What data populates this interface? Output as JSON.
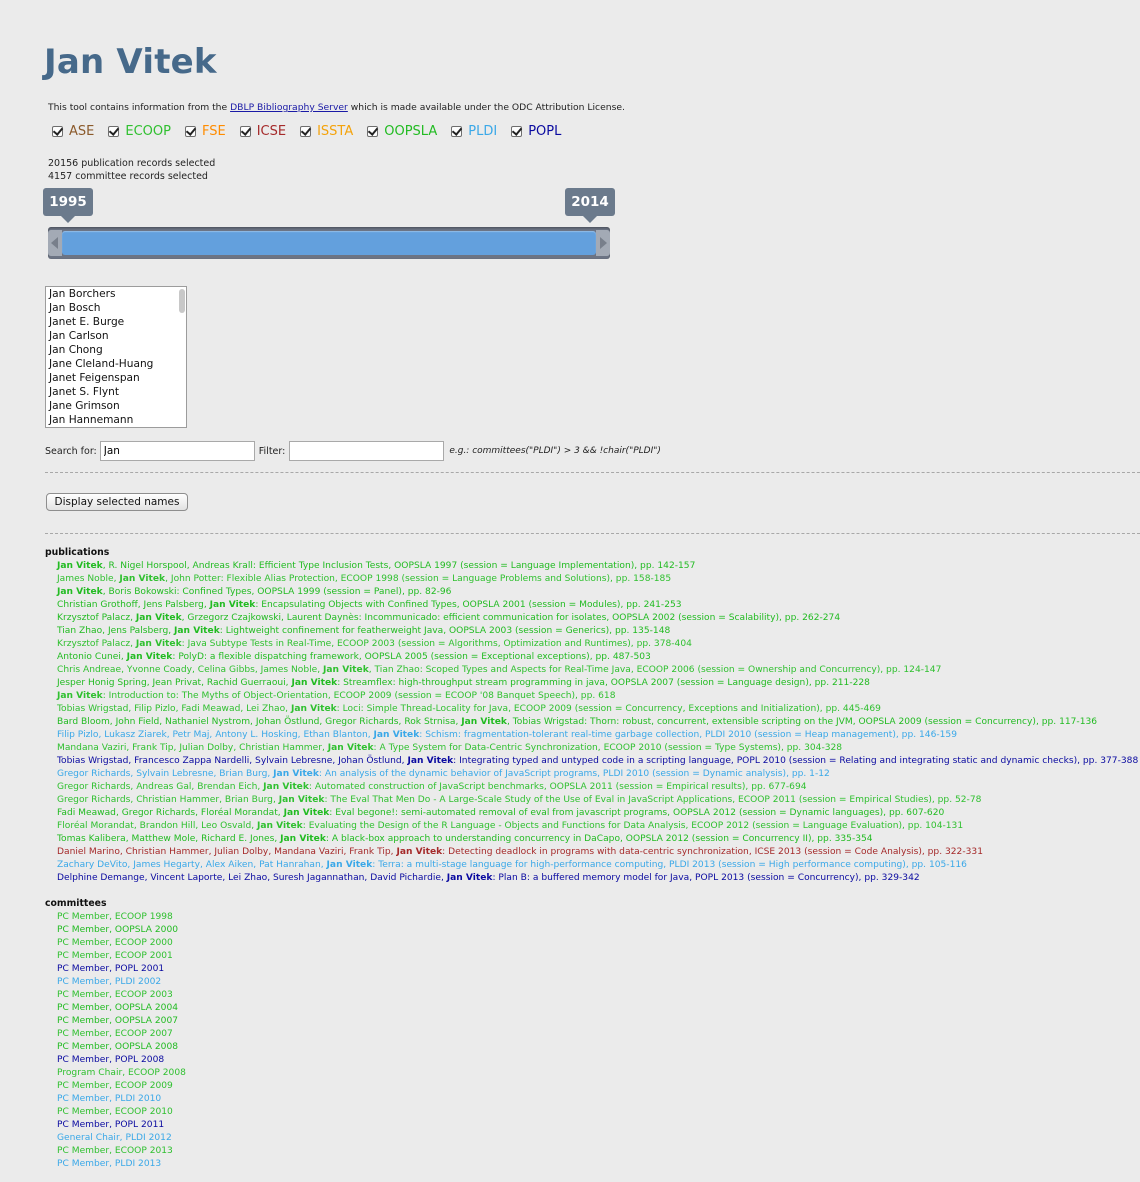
{
  "colors": {
    "ASE": "#8b5a2b",
    "ECOOP": "#30c030",
    "FSE": "#ff8c00",
    "ICSE": "#a52a2a",
    "ISSTA": "#f4a30b",
    "OOPSLA": "#22bb22",
    "PLDI": "#3aa8e8",
    "POPL": "#0a0aa0"
  },
  "title": "Jan Vitek",
  "intro": {
    "before": "This tool contains information from the ",
    "link": "DBLP Bibliography Server",
    "after": " which is made available under the ODC Attribution License."
  },
  "conferences": [
    {
      "label": "ASE",
      "color": "#8b5a2b"
    },
    {
      "label": "ECOOP",
      "color": "#30c030"
    },
    {
      "label": "FSE",
      "color": "#ff8c00"
    },
    {
      "label": "ICSE",
      "color": "#a52a2a"
    },
    {
      "label": "ISSTA",
      "color": "#f4a30b"
    },
    {
      "label": "OOPSLA",
      "color": "#22bb22"
    },
    {
      "label": "PLDI",
      "color": "#3aa8e8"
    },
    {
      "label": "POPL",
      "color": "#0a0aa0"
    }
  ],
  "counts": {
    "publications": "20156 publication records selected",
    "committees": "4157 committee records selected"
  },
  "slider": {
    "from": "1995",
    "to": "2014"
  },
  "names": [
    "Jan Borchers",
    "Jan Bosch",
    "Janet E. Burge",
    "Jan Carlson",
    "Jan Chong",
    "Jane Cleland-Huang",
    "Janet Feigenspan",
    "Janet S. Flynt",
    "Jane Grimson",
    "Jan Hannemann"
  ],
  "search": {
    "label": "Search for:",
    "value": "Jan",
    "filter_label": "Filter:",
    "filter_value": "",
    "example": "e.g.: committees(\"PLDI\") > 3 && !chair(\"PLDI\")"
  },
  "display_button": "Display selected names",
  "publications_header": "publications",
  "publications": [
    {
      "conf": "OOPSLA",
      "pre": "",
      "bold": "Jan Vitek",
      "post": ", R. Nigel Horspool, Andreas Krall: Efficient Type Inclusion Tests, OOPSLA 1997 (session = Language Implementation), pp. 142-157"
    },
    {
      "conf": "ECOOP",
      "pre": "James Noble, ",
      "bold": "Jan Vitek",
      "post": ", John Potter: Flexible Alias Protection, ECOOP 1998 (session = Language Problems and Solutions), pp. 158-185"
    },
    {
      "conf": "OOPSLA",
      "pre": "",
      "bold": "Jan Vitek",
      "post": ", Boris Bokowski: Confined Types, OOPSLA 1999 (session = Panel), pp. 82-96"
    },
    {
      "conf": "OOPSLA",
      "pre": "Christian Grothoff, Jens Palsberg, ",
      "bold": "Jan Vitek",
      "post": ": Encapsulating Objects with Confined Types, OOPSLA 2001 (session = Modules), pp. 241-253"
    },
    {
      "conf": "OOPSLA",
      "pre": "Krzysztof Palacz, ",
      "bold": "Jan Vitek",
      "post": ", Grzegorz Czajkowski, Laurent Daynès: Incommunicado: efficient communication for isolates, OOPSLA 2002 (session = Scalability), pp. 262-274"
    },
    {
      "conf": "OOPSLA",
      "pre": "Tian Zhao, Jens Palsberg, ",
      "bold": "Jan Vitek",
      "post": ": Lightweight confinement for featherweight Java, OOPSLA 2003 (session = Generics), pp. 135-148"
    },
    {
      "conf": "ECOOP",
      "pre": "Krzysztof Palacz, ",
      "bold": "Jan Vitek",
      "post": ": Java Subtype Tests in Real-Time, ECOOP 2003 (session = Algorithms, Optimization and Runtimes), pp. 378-404"
    },
    {
      "conf": "OOPSLA",
      "pre": "Antonio Cunei, ",
      "bold": "Jan Vitek",
      "post": ": PolyD: a flexible dispatching framework, OOPSLA 2005 (session = Exceptional exceptions), pp. 487-503"
    },
    {
      "conf": "ECOOP",
      "pre": "Chris Andreae, Yvonne Coady, Celina Gibbs, James Noble, ",
      "bold": "Jan Vitek",
      "post": ", Tian Zhao: Scoped Types and Aspects for Real-Time Java, ECOOP 2006 (session = Ownership and Concurrency), pp. 124-147"
    },
    {
      "conf": "OOPSLA",
      "pre": "Jesper Honig Spring, Jean Privat, Rachid Guerraoui, ",
      "bold": "Jan Vitek",
      "post": ": Streamflex: high-throughput stream programming in java, OOPSLA 2007 (session = Language design), pp. 211-228"
    },
    {
      "conf": "ECOOP",
      "pre": "",
      "bold": "Jan Vitek",
      "post": ": Introduction to: The Myths of Object-Orientation, ECOOP 2009 (session = ECOOP '08 Banquet Speech), pp. 618"
    },
    {
      "conf": "ECOOP",
      "pre": "Tobias Wrigstad, Filip Pizlo, Fadi Meawad, Lei Zhao, ",
      "bold": "Jan Vitek",
      "post": ": Loci: Simple Thread-Locality for Java, ECOOP 2009 (session = Concurrency, Exceptions and Initialization), pp. 445-469"
    },
    {
      "conf": "OOPSLA",
      "pre": "Bard Bloom, John Field, Nathaniel Nystrom, Johan Östlund, Gregor Richards, Rok Strnisa, ",
      "bold": "Jan Vitek",
      "post": ", Tobias Wrigstad: Thorn: robust, concurrent, extensible scripting on the JVM, OOPSLA 2009 (session = Concurrency), pp. 117-136"
    },
    {
      "conf": "PLDI",
      "pre": "Filip Pizlo, Lukasz Ziarek, Petr Maj, Antony L. Hosking, Ethan Blanton, ",
      "bold": "Jan Vitek",
      "post": ": Schism: fragmentation-tolerant real-time garbage collection, PLDI 2010 (session = Heap management), pp. 146-159"
    },
    {
      "conf": "ECOOP",
      "pre": "Mandana Vaziri, Frank Tip, Julian Dolby, Christian Hammer, ",
      "bold": "Jan Vitek",
      "post": ": A Type System for Data-Centric Synchronization, ECOOP 2010 (session = Type Systems), pp. 304-328"
    },
    {
      "conf": "POPL",
      "pre": "Tobias Wrigstad, Francesco Zappa Nardelli, Sylvain Lebresne, Johan Östlund, ",
      "bold": "Jan Vitek",
      "post": ": Integrating typed and untyped code in a scripting language, POPL 2010 (session = Relating and integrating static and dynamic checks), pp. 377-388"
    },
    {
      "conf": "PLDI",
      "pre": "Gregor Richards, Sylvain Lebresne, Brian Burg, ",
      "bold": "Jan Vitek",
      "post": ": An analysis of the dynamic behavior of JavaScript programs, PLDI 2010 (session = Dynamic analysis), pp. 1-12"
    },
    {
      "conf": "ECOOP",
      "pre": "Gregor Richards, Andreas Gal, Brendan Eich, ",
      "bold": "Jan Vitek",
      "post": ": Automated construction of JavaScript benchmarks, OOPSLA 2011 (session = Empirical results), pp. 677-694"
    },
    {
      "conf": "ECOOP",
      "pre": "Gregor Richards, Christian Hammer, Brian Burg, ",
      "bold": "Jan Vitek",
      "post": ": The Eval That Men Do - A Large-Scale Study of the Use of Eval in JavaScript Applications, ECOOP 2011 (session = Empirical Studies), pp. 52-78"
    },
    {
      "conf": "OOPSLA",
      "pre": "Fadi Meawad, Gregor Richards, Floréal Morandat, ",
      "bold": "Jan Vitek",
      "post": ": Eval begone!: semi-automated removal of eval from javascript programs, OOPSLA 2012 (session = Dynamic languages), pp. 607-620"
    },
    {
      "conf": "ECOOP",
      "pre": "Floréal Morandat, Brandon Hill, Leo Osvald, ",
      "bold": "Jan Vitek",
      "post": ": Evaluating the Design of the R Language - Objects and Functions for Data Analysis, ECOOP 2012 (session = Language Evaluation), pp. 104-131"
    },
    {
      "conf": "OOPSLA",
      "pre": "Tomas Kalibera, Matthew Mole, Richard E. Jones, ",
      "bold": "Jan Vitek",
      "post": ": A black-box approach to understanding concurrency in DaCapo, OOPSLA 2012 (session = Concurrency II), pp. 335-354"
    },
    {
      "conf": "ICSE",
      "pre": "Daniel Marino, Christian Hammer, Julian Dolby, Mandana Vaziri, Frank Tip, ",
      "bold": "Jan Vitek",
      "post": ": Detecting deadlock in programs with data-centric synchronization, ICSE 2013 (session = Code Analysis), pp. 322-331"
    },
    {
      "conf": "PLDI",
      "pre": "Zachary DeVito, James Hegarty, Alex Aiken, Pat Hanrahan, ",
      "bold": "Jan Vitek",
      "post": ": Terra: a multi-stage language for high-performance computing, PLDI 2013 (session = High performance computing), pp. 105-116"
    },
    {
      "conf": "POPL",
      "pre": "Delphine Demange, Vincent Laporte, Lei Zhao, Suresh Jagannathan, David Pichardie, ",
      "bold": "Jan Vitek",
      "post": ": Plan B: a buffered memory model for Java, POPL 2013 (session = Concurrency), pp. 329-342"
    }
  ],
  "committees_header": "committees",
  "committees": [
    {
      "conf": "ECOOP",
      "text": "PC Member, ECOOP 1998"
    },
    {
      "conf": "OOPSLA",
      "text": "PC Member, OOPSLA 2000"
    },
    {
      "conf": "ECOOP",
      "text": "PC Member, ECOOP 2000"
    },
    {
      "conf": "ECOOP",
      "text": "PC Member, ECOOP 2001"
    },
    {
      "conf": "POPL",
      "text": "PC Member, POPL 2001"
    },
    {
      "conf": "PLDI",
      "text": "PC Member, PLDI 2002"
    },
    {
      "conf": "ECOOP",
      "text": "PC Member, ECOOP 2003"
    },
    {
      "conf": "OOPSLA",
      "text": "PC Member, OOPSLA 2004"
    },
    {
      "conf": "OOPSLA",
      "text": "PC Member, OOPSLA 2007"
    },
    {
      "conf": "ECOOP",
      "text": "PC Member, ECOOP 2007"
    },
    {
      "conf": "OOPSLA",
      "text": "PC Member, OOPSLA 2008"
    },
    {
      "conf": "POPL",
      "text": "PC Member, POPL 2008"
    },
    {
      "conf": "ECOOP",
      "text": "Program Chair, ECOOP 2008"
    },
    {
      "conf": "ECOOP",
      "text": "PC Member, ECOOP 2009"
    },
    {
      "conf": "PLDI",
      "text": "PC Member, PLDI 2010"
    },
    {
      "conf": "ECOOP",
      "text": "PC Member, ECOOP 2010"
    },
    {
      "conf": "POPL",
      "text": "PC Member, POPL 2011"
    },
    {
      "conf": "PLDI",
      "text": "General Chair, PLDI 2012"
    },
    {
      "conf": "ECOOP",
      "text": "PC Member, ECOOP 2013"
    },
    {
      "conf": "PLDI",
      "text": "PC Member, PLDI 2013"
    }
  ]
}
